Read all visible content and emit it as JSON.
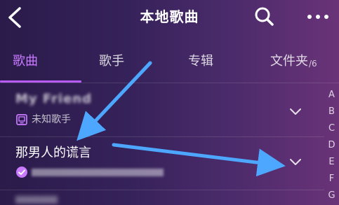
{
  "header": {
    "title": "本地歌曲"
  },
  "tabs": [
    {
      "label": "歌曲",
      "active": true
    },
    {
      "label": "歌手",
      "active": false
    },
    {
      "label": "专辑",
      "active": false
    },
    {
      "label": "文件夹",
      "count": "/6",
      "active": false
    }
  ],
  "songs": [
    {
      "title": "My Friend",
      "subtitle": "未知歌手",
      "title_blurred": true,
      "subtitle_blurred": false,
      "icon": "device-icon"
    },
    {
      "title": "那男人的谎言",
      "subtitle": "",
      "title_blurred": false,
      "subtitle_blurred": true,
      "icon": "check-badge-icon"
    }
  ],
  "index_letters": [
    "A",
    "B",
    "C",
    "D",
    "E",
    "F",
    "G"
  ],
  "colors": {
    "accent": "#c97aff",
    "indicator": "#b85cff",
    "arrow": "#4ea7ff",
    "background_start": "#2a1b4a",
    "background_end": "#6a3378"
  }
}
